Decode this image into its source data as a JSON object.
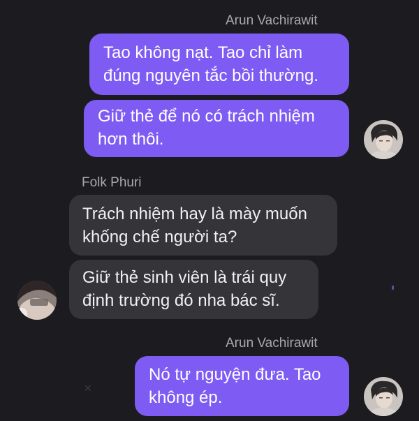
{
  "conversation": {
    "groups": [
      {
        "sender": "Arun Vachirawit",
        "direction": "outgoing",
        "messages": [
          "Tao không nạt. Tao chỉ làm\nđúng nguyên tắc bồi thường.",
          "Giữ thẻ để nó có trách nhiệm\nhơn thôi."
        ]
      },
      {
        "sender": "Folk Phuri",
        "direction": "incoming",
        "messages": [
          "Trách nhiệm hay là mày muốn\nkhống chế người ta?",
          "Giữ thẻ sinh viên là trái quy\nđịnh trường đó nha bác sĩ."
        ]
      },
      {
        "sender": "Arun Vachirawit",
        "direction": "outgoing",
        "messages": [
          "Nó tự nguyện đưa. Tao\nkhông ép."
        ]
      }
    ]
  },
  "colors": {
    "background": "#1c1b20",
    "outgoing_bubble": "#7e5cf3",
    "incoming_bubble": "#353439",
    "sender_name": "#a8a8ad"
  }
}
